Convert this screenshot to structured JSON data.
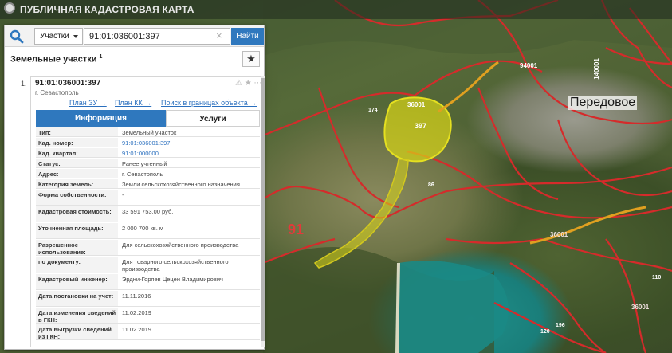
{
  "app": {
    "title": "ПУБЛИЧНАЯ КАДАСТРОВАЯ КАРТА"
  },
  "search": {
    "type_selected": "Участки",
    "query": "91:01:036001:397",
    "find_label": "Найти"
  },
  "results": {
    "title": "Земельные участки",
    "count": "1",
    "item": {
      "index": "1.",
      "cadastral_number": "91:01:036001:397",
      "city": "г. Севастополь",
      "links": [
        "План ЗУ →",
        "План КК →",
        "Поиск в границах объекта →"
      ]
    }
  },
  "tabs": {
    "info": "Информация",
    "services": "Услуги"
  },
  "attributes": [
    {
      "key": "Тип:",
      "value": "Земельный участок"
    },
    {
      "key": "Кад. номер:",
      "value": "91:01:036001:397"
    },
    {
      "key": "Кад. квартал:",
      "value": "91:01:000000"
    },
    {
      "key": "Статус:",
      "value": "Ранее учтенный"
    },
    {
      "key": "Адрес:",
      "value": "г. Севастополь"
    },
    {
      "key": "Категория земель:",
      "value": "Земли сельскохозяйственного назначения"
    },
    {
      "key": "Форма собственности:",
      "value": "-"
    },
    {
      "key": "Кадастровая стоимость:",
      "value": "33 591 753,00 руб."
    },
    {
      "key": "Уточненная площадь:",
      "value": "2 000 700 кв. м"
    },
    {
      "key": "Разрешенное использование:",
      "value": "Для сельскохозяйственного производства"
    },
    {
      "key": "по документу:",
      "value": "Для товарного сельскохозяйственного производства"
    },
    {
      "key": "Кадастровый инженер:",
      "value": "Эрдни-Горяев Цецен Владимирович"
    },
    {
      "key": "Дата постановки на учет:",
      "value": "11.11.2016"
    },
    {
      "key": "Дата изменения сведений в ГКН:",
      "value": "11.02.2019"
    },
    {
      "key": "Дата выгрузки сведений из ГКН:",
      "value": "11.02.2019"
    }
  ],
  "map": {
    "village": "Передовое",
    "region": "91",
    "parcel_number": "397",
    "parcel_quarter": "36001",
    "quarter_left": "36001",
    "quarter_right": "36001",
    "num_174": "174",
    "num_86": "86",
    "num_110": "110",
    "num_196": "196",
    "num_120": "120",
    "num_lot_a": "94001",
    "num_lot_b": "140001"
  },
  "colors": {
    "accent": "#2f78be",
    "boundary": "#d52b2b",
    "parcel_fill": "#d8d617",
    "road": "#e0a020"
  }
}
